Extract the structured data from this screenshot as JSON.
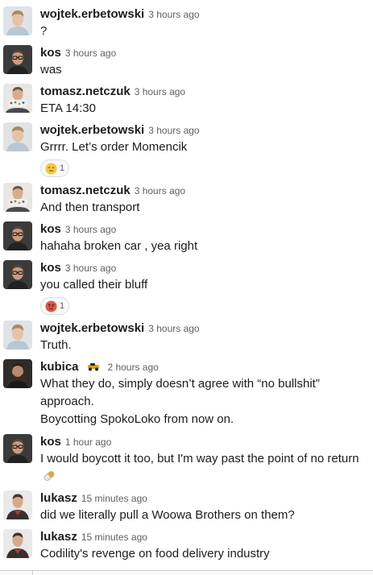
{
  "messages": [
    {
      "author": "wojtek.erbetowski",
      "time": "3 hours ago",
      "lines": [
        "?"
      ],
      "avatar": "avatar-wojtek"
    },
    {
      "author": "kos",
      "time": "3 hours ago",
      "lines": [
        "was"
      ],
      "avatar": "avatar-kos"
    },
    {
      "author": "tomasz.netczuk",
      "time": "3 hours ago",
      "lines": [
        "ETA 14:30"
      ],
      "avatar": "avatar-tomasz"
    },
    {
      "author": "wojtek.erbetowski",
      "time": "3 hours ago",
      "lines": [
        "Grrrr. Let’s order Momencik"
      ],
      "avatar": "avatar-wojtek",
      "reaction": {
        "emoji": "unamused-face-icon",
        "count": "1"
      }
    },
    {
      "author": "tomasz.netczuk",
      "time": "3 hours ago",
      "lines": [
        "And then transport"
      ],
      "avatar": "avatar-tomasz"
    },
    {
      "author": "kos",
      "time": "3 hours ago",
      "lines": [
        "hahaha broken car , yea right"
      ],
      "avatar": "avatar-kos"
    },
    {
      "author": "kos",
      "time": "3 hours ago",
      "lines": [
        "you called their bluff"
      ],
      "avatar": "avatar-kos",
      "reaction": {
        "emoji": "angry-face-icon",
        "count": "1"
      }
    },
    {
      "author": "wojtek.erbetowski",
      "time": "3 hours ago",
      "lines": [
        "Truth."
      ],
      "avatar": "avatar-wojtek"
    },
    {
      "author": "kubica",
      "status_emoji": "race-car-icon",
      "time": "2 hours ago",
      "lines": [
        "What they do, simply doesn’t agree with “no bullshit”",
        "approach.",
        "Boycotting SpokoLoko from now on."
      ],
      "avatar": "avatar-kubica"
    },
    {
      "author": "kos",
      "time": "1 hour ago",
      "lines": [
        "I would boycott it too, but I'm way past the point of no return"
      ],
      "avatar": "avatar-kos",
      "trailing_emoji": "pill-icon"
    },
    {
      "author": "lukasz",
      "time": "15 minutes ago",
      "lines": [
        "did we literally pull a Woowa Brothers on them?"
      ],
      "avatar": "avatar-lukasz"
    },
    {
      "author": "lukasz",
      "time": "15 minutes ago",
      "lines": [
        "Codility's revenge on food delivery industry"
      ],
      "avatar": "avatar-lukasz"
    }
  ]
}
